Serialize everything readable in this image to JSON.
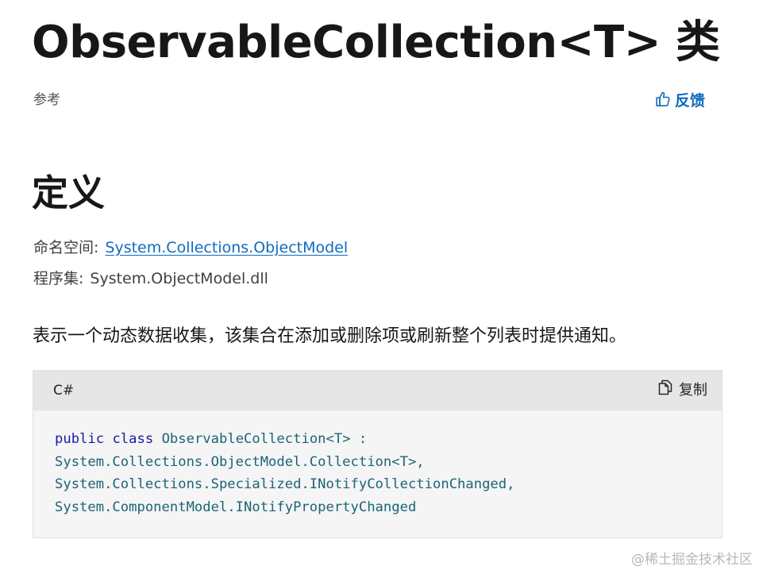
{
  "page": {
    "title": "ObservableCollection<T> 类",
    "reference_label": "参考",
    "feedback": {
      "label": "反馈",
      "icon": "thumbs-up-icon",
      "color": "#0f6cbd"
    }
  },
  "definition": {
    "heading": "定义",
    "namespace_label": "命名空间:",
    "namespace_value": "System.Collections.ObjectModel",
    "assembly_label": "程序集:",
    "assembly_value": "System.ObjectModel.dll"
  },
  "description": "表示一个动态数据收集，该集合在添加或删除项或刷新整个列表时提供通知。",
  "code": {
    "language": "C#",
    "copy_label": "复制",
    "copy_icon": "copy-icon",
    "tokens": {
      "kw_public": "public",
      "kw_class": "class",
      "class_decl": "ObservableCollection<T> :",
      "line2": "System.Collections.ObjectModel.Collection<T>,",
      "line3": "System.Collections.Specialized.INotifyCollectionChanged,",
      "line4": "System.ComponentModel.INotifyPropertyChanged"
    },
    "keyword_color": "#1a1aa6",
    "type_color": "#1a6477"
  },
  "watermark": "@稀土掘金技术社区"
}
